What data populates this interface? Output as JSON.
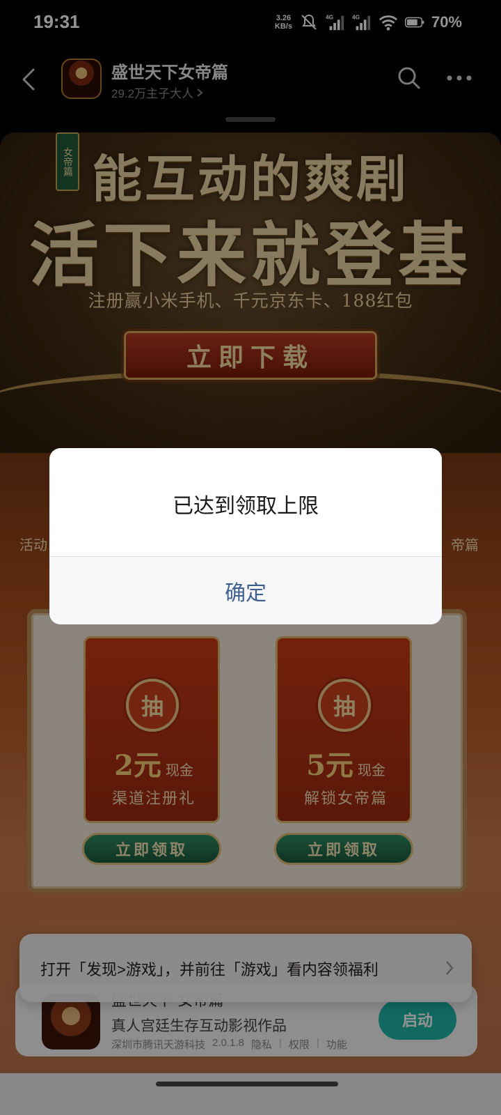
{
  "status_bar": {
    "time": "19:31",
    "net_speed_value": "3.26",
    "net_speed_unit": "KB/s",
    "signal_1": "4G",
    "signal_2": "4G",
    "battery": "70%"
  },
  "header": {
    "title": "盛世天下女帝篇",
    "subtitle": "29.2万主子大人",
    "icons": [
      "back-icon",
      "search-icon",
      "more-icon"
    ]
  },
  "banner": {
    "tag": "女帝篇",
    "headline_1": "能互动的爽剧",
    "headline_2": "活下来就登基",
    "promo": "注册赢小米手机、千元京东卡、188红包",
    "download_label": "立即下载"
  },
  "activity": {
    "left_label": "活动",
    "right_label": "帝篇",
    "cards": [
      {
        "seal": "抽",
        "amount": "2元",
        "unit": "现金",
        "desc": "渠道注册礼",
        "button": "立即领取"
      },
      {
        "seal": "抽",
        "amount": "5元",
        "unit": "现金",
        "desc": "解锁女帝篇",
        "button": "立即领取"
      }
    ]
  },
  "toast": {
    "text": "打开「发现>游戏」，并前往「游戏」看内容领福利"
  },
  "bottom_card": {
    "title": "盛世天下·女帝篇",
    "description": "真人宫廷生存互动影视作品",
    "developer": "深圳市腾讯天游科技",
    "version": "2.0.1.8",
    "privacy": "隐私",
    "permissions": "权限",
    "features": "功能",
    "start_label": "启动"
  },
  "dialog": {
    "message": "已达到领取上限",
    "confirm_label": "确定"
  },
  "colors": {
    "accent_teal": "#1fb5a6",
    "dialog_button": "#3f5f8e"
  }
}
